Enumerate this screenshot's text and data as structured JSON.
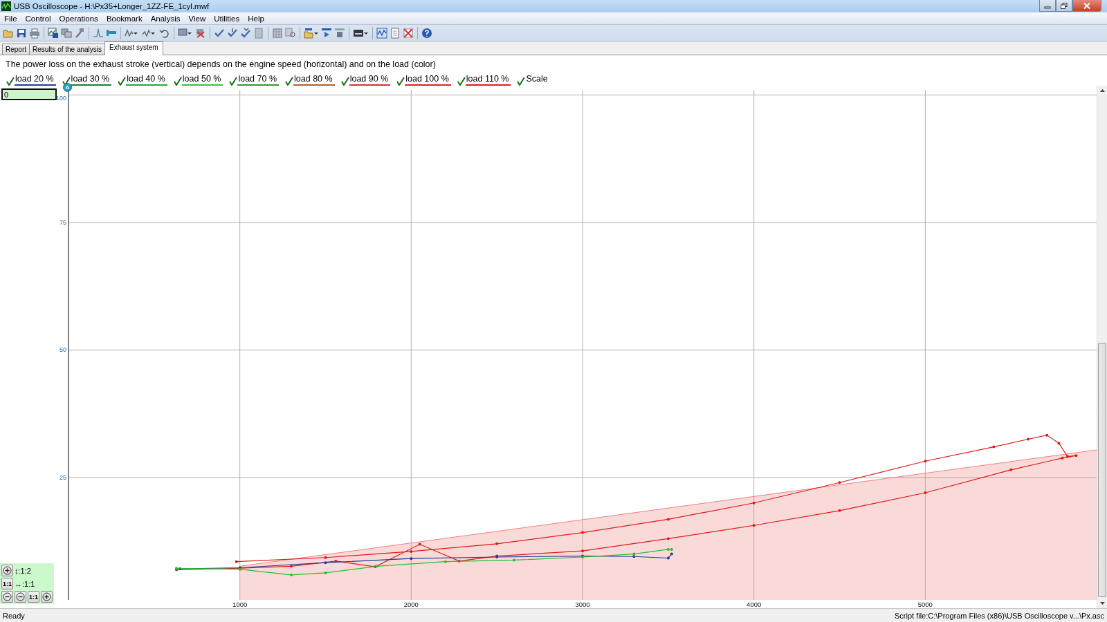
{
  "window": {
    "title": "USB Oscilloscope - H:\\Px35+Longer_1ZZ-FE_1cyl.mwf"
  },
  "menu": [
    "File",
    "Control",
    "Operations",
    "Bookmark",
    "Analysis",
    "View",
    "Utilities",
    "Help"
  ],
  "tabs": [
    {
      "label": "Report",
      "selected": false
    },
    {
      "label": "Results of the analysis",
      "selected": false
    },
    {
      "label": "Exhaust system",
      "selected": true
    }
  ],
  "description": "The power loss on the exhaust stroke (vertical) depends on the engine speed (horizontal) and on the load (color)",
  "legend": [
    {
      "label": "load 20 %",
      "checked": true,
      "color": "#1f3c96"
    },
    {
      "label": "load 30 %",
      "checked": true,
      "color": "#1f7a3a"
    },
    {
      "label": "load 40 %",
      "checked": true,
      "color": "#22a83a"
    },
    {
      "label": "load 50 %",
      "checked": true,
      "color": "#2ec83c"
    },
    {
      "label": "load 70 %",
      "checked": true,
      "color": "#2a9a2a"
    },
    {
      "label": "load 80 %",
      "checked": true,
      "color": "#b0602a"
    },
    {
      "label": "load 90 %",
      "checked": true,
      "color": "#d83030"
    },
    {
      "label": "load 100 %",
      "checked": true,
      "color": "#e02020"
    },
    {
      "label": "load 110 %",
      "checked": true,
      "color": "#e81818"
    },
    {
      "label": "Scale",
      "checked": true,
      "kind": "scale"
    }
  ],
  "cursor_marker": "A",
  "offset_field": {
    "value": "0"
  },
  "zoom_controls": {
    "vertical_scale": "↕:1:2",
    "horizontal_scale": "↔:1:1",
    "reset_label": "1:1",
    "reset_label_2": "1:1"
  },
  "chart": {
    "chart_data": {
      "type": "line",
      "xlim": [
        0,
        6000
      ],
      "ylim": [
        1,
        101
      ],
      "xticks": [
        1000,
        2000,
        3000,
        4000,
        5000
      ],
      "yticks": [
        25,
        50,
        75,
        100
      ],
      "grid": true,
      "series": [
        {
          "type": "area",
          "color": "#f08080",
          "x": [
            1000,
            6000
          ],
          "values": [
            7.6,
            30.4
          ]
        },
        {
          "color": "#e01818",
          "x": [
            980,
            1500,
            2000,
            2500,
            3000,
            3500,
            4000,
            4500,
            5000,
            5400,
            5600,
            5710,
            5780,
            5830,
            5880,
            5800,
            5500,
            5000,
            4500,
            4000,
            3500,
            3000,
            2500,
            2280,
            2050,
            1790,
            1560,
            1300,
            1000,
            630
          ],
          "values": [
            8.5,
            9.3,
            10.5,
            12,
            14.2,
            16.8,
            20,
            24,
            28.2,
            31,
            32.5,
            33.3,
            31.7,
            29.1,
            29.3,
            28.8,
            26.5,
            22,
            18.5,
            15.6,
            13,
            10.6,
            9.6,
            8.6,
            11.9,
            7.5,
            8.6,
            7.6,
            7.2,
            6.9
          ]
        },
        {
          "color": "#1f3c96",
          "x": [
            650,
            1000,
            1500,
            2000,
            2500,
            3000,
            3300,
            3500,
            3520
          ],
          "values": [
            7.1,
            7.3,
            8.3,
            9.1,
            9.4,
            9.6,
            9.5,
            9.2,
            10
          ]
        },
        {
          "color": "#22c030",
          "x": [
            630,
            1000,
            1300,
            1500,
            1800,
            2200,
            2600,
            3000,
            3300,
            3500,
            3520
          ],
          "values": [
            7.2,
            7.0,
            5.9,
            6.3,
            7.6,
            8.5,
            8.8,
            9.4,
            10,
            10.9,
            10.9
          ]
        }
      ]
    }
  },
  "status_bar": {
    "left": "Ready",
    "right": "Script file:C:\\Program Files (x86)\\USB Oscilloscope v...\\Px.asc"
  }
}
